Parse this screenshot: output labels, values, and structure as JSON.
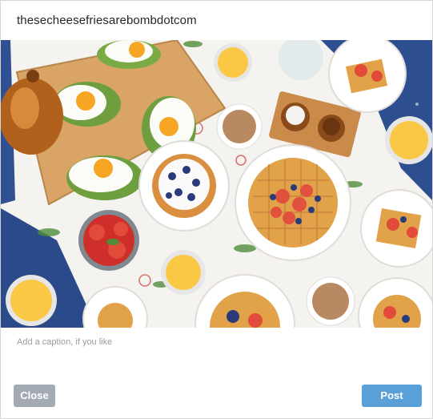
{
  "dialog": {
    "username": "thesecheesefriesarebombdotcom",
    "photo": {
      "icon": "breakfast-table-photo",
      "colors": {
        "tablecloth": "#f5f3ef",
        "board": "#d9a466",
        "denim": "#2a4a8a",
        "juice": "#fbc845"
      }
    },
    "caption": {
      "placeholder": "Add a caption, if you like",
      "value": ""
    },
    "buttons": {
      "close_label": "Close",
      "post_label": "Post"
    },
    "colors": {
      "close_bg": "#a3aab3",
      "post_bg": "#5aa0d8"
    }
  }
}
